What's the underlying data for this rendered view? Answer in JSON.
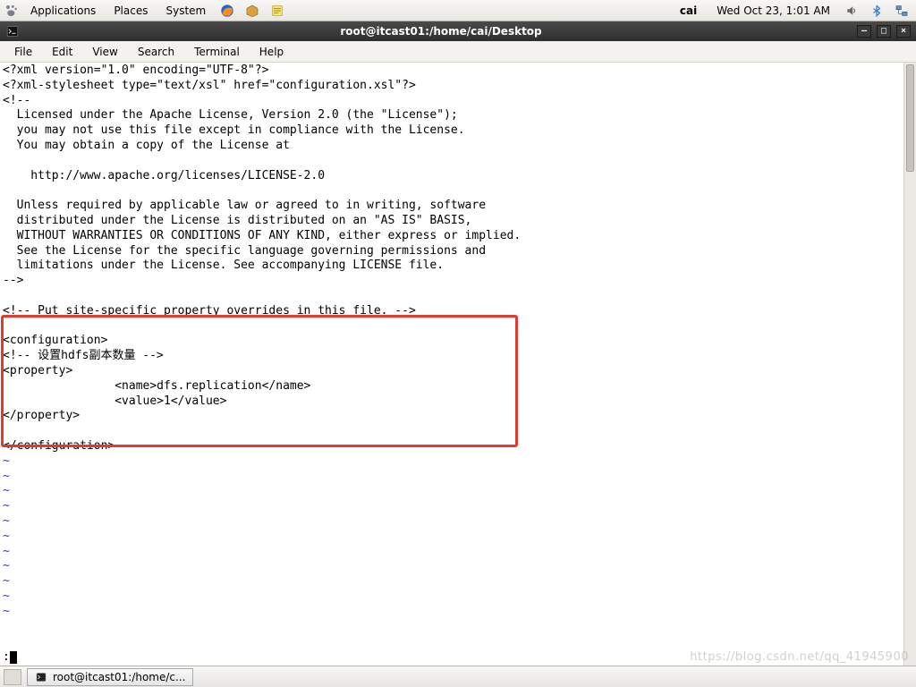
{
  "gnome_panel": {
    "menus": [
      "Applications",
      "Places",
      "System"
    ],
    "user": "cai",
    "clock": "Wed Oct 23,  1:01 AM"
  },
  "window": {
    "title": "root@itcast01:/home/cai/Desktop"
  },
  "term_menus": [
    "File",
    "Edit",
    "View",
    "Search",
    "Terminal",
    "Help"
  ],
  "vim": {
    "content": "<?xml version=\"1.0\" encoding=\"UTF-8\"?>\n<?xml-stylesheet type=\"text/xsl\" href=\"configuration.xsl\"?>\n<!--\n  Licensed under the Apache License, Version 2.0 (the \"License\");\n  you may not use this file except in compliance with the License.\n  You may obtain a copy of the License at\n\n    http://www.apache.org/licenses/LICENSE-2.0\n\n  Unless required by applicable law or agreed to in writing, software\n  distributed under the License is distributed on an \"AS IS\" BASIS,\n  WITHOUT WARRANTIES OR CONDITIONS OF ANY KIND, either express or implied.\n  See the License for the specific language governing permissions and\n  limitations under the License. See accompanying LICENSE file.\n-->\n\n<!-- Put site-specific property overrides in this file. -->\n\n<configuration>\n<!-- 设置hdfs副本数量 -->\n<property>\n                <name>dfs.replication</name>\n                <value>1</value>\n</property>\n\n</configuration>",
    "tilde_lines": "~\n~\n~\n~\n~\n~\n~\n~\n~\n~\n~",
    "status": ":"
  },
  "taskbar": {
    "task_label": "root@itcast01:/home/c..."
  },
  "watermark": "https://blog.csdn.net/qq_41945900"
}
